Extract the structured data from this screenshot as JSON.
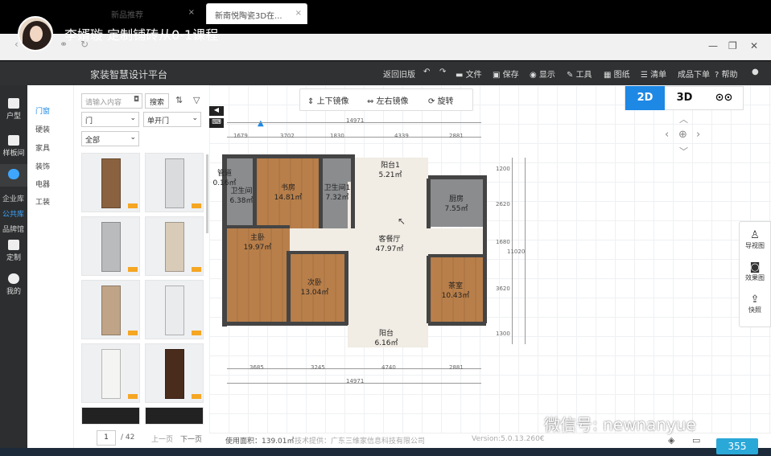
{
  "stream": {
    "title": "李婿璇 定制铺砖从0-1课程"
  },
  "browser": {
    "tabs": [
      {
        "label": "新品推荐"
      },
      {
        "label": "新南悦陶瓷3D在..."
      }
    ]
  },
  "app": {
    "title": "家装智慧设计平台",
    "header_items": [
      "返回旧版",
      "文件",
      "保存",
      "显示",
      "工具",
      "图纸",
      "清单",
      "成品下单",
      "帮助"
    ]
  },
  "leftnav": {
    "items": [
      "户型",
      "样板间",
      "定制",
      "我的"
    ],
    "library_items": [
      "企业库",
      "公共库",
      "品牌馆"
    ]
  },
  "categories": [
    "门窗",
    "硬装",
    "家具",
    "装饰",
    "电器",
    "工装"
  ],
  "product_panel": {
    "search_placeholder": "请输入内容",
    "search_button": "搜索",
    "filter1": "门",
    "filter2": "单开门",
    "filter3": "全部",
    "pagination": {
      "page": "1",
      "total": "/ 42",
      "prev": "上一页",
      "next": "下一页"
    },
    "product_colors": [
      "#8a6240",
      "#d9dbdd",
      "#b9bbbd",
      "#d8cbb8",
      "#bfa488",
      "#e9ebed",
      "#f4f4f2",
      "#4a2c1c"
    ]
  },
  "toolbar": {
    "flip_v": "上下镜像",
    "flip_h": "左右镜像",
    "rotate": "旋转"
  },
  "view_modes": [
    "2D",
    "3D",
    "VR"
  ],
  "floorplan": {
    "rooms": [
      {
        "name": "管道",
        "area": "0.16㎡"
      },
      {
        "name": "卫生间",
        "area": "6.38㎡"
      },
      {
        "name": "书房",
        "area": "14.81㎡"
      },
      {
        "name": "卫生间1",
        "area": "7.32㎡"
      },
      {
        "name": "阳台1",
        "area": "5.21㎡"
      },
      {
        "name": "厨房",
        "area": "7.55㎡"
      },
      {
        "name": "主卧",
        "area": "19.97㎡"
      },
      {
        "name": "次卧",
        "area": "13.04㎡"
      },
      {
        "name": "客餐厅",
        "area": "47.97㎡"
      },
      {
        "name": "茶室",
        "area": "10.43㎡"
      },
      {
        "name": "阳台",
        "area": "6.16㎡"
      }
    ],
    "dims_top_total": "14971",
    "dims_top": [
      "1679",
      "3702",
      "1830",
      "4339",
      "2881"
    ],
    "dims_bottom": [
      "3685",
      "3245",
      "4740",
      "2881"
    ],
    "dims_bottom_total": "14971",
    "dims_right": [
      "1200",
      "2620",
      "1680",
      "3620",
      "1300"
    ],
    "dims_right_total": "11020"
  },
  "right_tools": [
    "导视图",
    "效果图",
    "快照"
  ],
  "status": {
    "area": "使用面积：139.01㎡",
    "support": "技术提供：广东三维家信息科技有限公司",
    "version": "Version:5.0.13.260€"
  },
  "watermark": "微信号: newnanyue",
  "badge": "355"
}
